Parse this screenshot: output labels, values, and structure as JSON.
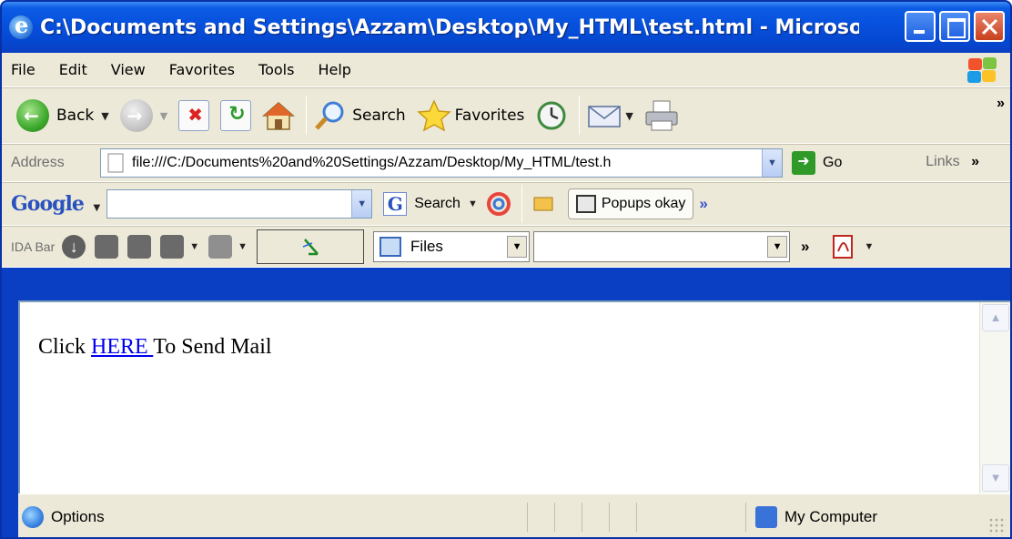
{
  "window": {
    "title": "C:\\Documents and Settings\\Azzam\\Desktop\\My_HTML\\test.html - Microso..."
  },
  "menu": {
    "items": [
      "File",
      "Edit",
      "View",
      "Favorites",
      "Tools",
      "Help"
    ]
  },
  "standard_toolbar": {
    "back_label": "Back",
    "search_label": "Search",
    "favorites_label": "Favorites",
    "chevron": "»"
  },
  "address_bar": {
    "label": "Address",
    "url": "file:///C:/Documents%20and%20Settings/Azzam/Desktop/My_HTML/test.h",
    "go_label": "Go",
    "links_label": "Links",
    "chevron": "»"
  },
  "google_toolbar": {
    "logo": "Google",
    "search_label": "Search",
    "popups_label": "Popups okay",
    "chevron": "»"
  },
  "ida_bar": {
    "label": "IDA Bar",
    "files_label": "Files",
    "chevron": "»"
  },
  "page": {
    "prefix": "Click ",
    "link_text": "HERE ",
    "suffix": "To Send Mail"
  },
  "status_bar": {
    "left_text": "Options",
    "zone_text": "My Computer"
  },
  "colors": {
    "titlebar": "#0650dd",
    "chrome": "#ece9d8",
    "link": "#0000ee"
  },
  "icons": [
    "ie-icon",
    "back-icon",
    "forward-icon",
    "stop-icon",
    "refresh-icon",
    "home-icon",
    "search-icon",
    "favorites-star-icon",
    "history-icon",
    "mail-icon",
    "print-icon",
    "go-icon",
    "windows-logo-icon",
    "computer-icon",
    "acrobat-icon"
  ]
}
